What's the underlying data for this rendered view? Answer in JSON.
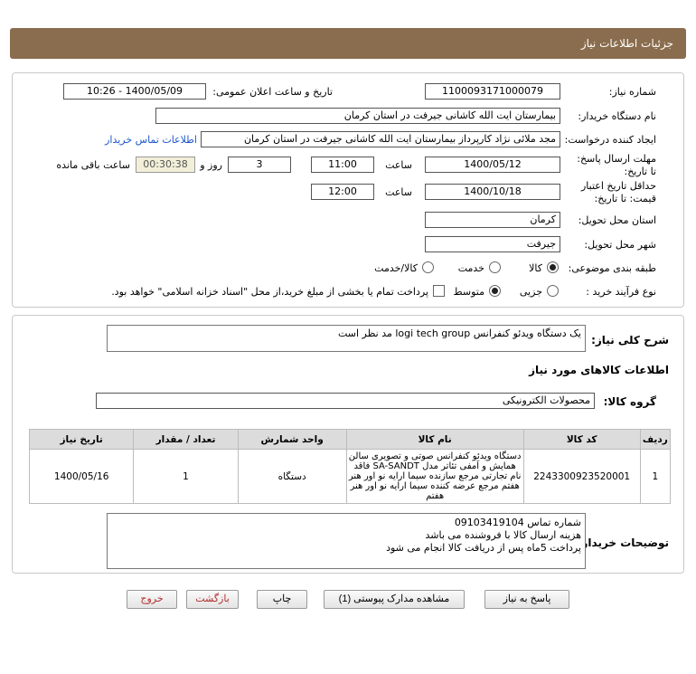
{
  "header": {
    "title": "جزئیات اطلاعات نیاز"
  },
  "form": {
    "need_number_label": "شماره نیاز:",
    "need_number": "1100093171000079",
    "announce_label": "تاریخ و ساعت اعلان عمومی:",
    "announce_value": "1400/05/09 - 10:26",
    "buyer_org_label": "نام دستگاه خریدار:",
    "buyer_org": "بیمارستان ایت الله کاشانی جیرفت در استان کرمان",
    "creator_label": "ایجاد کننده درخواست:",
    "creator": "مجد ملائی نژاد کارپرداز بیمارستان ایت الله کاشانی جیرفت در استان کرمان",
    "contact_link": "اطلاعات تماس خریدار",
    "deadline_label": "مهلت ارسال پاسخ: تا تاریخ:",
    "deadline_date": "1400/05/12",
    "time_label": "ساعت",
    "deadline_time": "11:00",
    "days_value": "3",
    "days_label": "روز و",
    "remaining_time": "00:30:38",
    "remaining_label": "ساعت باقی مانده",
    "validity_label": "حداقل تاریخ اعتبار قیمت: تا تاریخ:",
    "validity_date": "1400/10/18",
    "validity_time_label": "ساعت",
    "validity_time": "12:00",
    "province_label": "استان محل تحویل:",
    "province": "کرمان",
    "city_label": "شهر محل تحویل:",
    "city": "جیرفت",
    "category_label": "طبقه بندی موضوعی:",
    "category_options": [
      "کالا",
      "خدمت",
      "کالا/خدمت"
    ],
    "process_label": "نوع فرآیند خرید :",
    "process_options": [
      "جزیی",
      "متوسط"
    ],
    "payment_note": "پرداخت تمام یا بخشی از مبلغ خرید،از محل \"اسناد خزانه اسلامی\" خواهد بود."
  },
  "details": {
    "summary_label": "شرح کلی نیاز:",
    "summary": "یک دستگاه ویدئو کنفرانس logi tech group  مد نظر است",
    "goods_info_title": "اطلاعات کالاهای مورد نیاز",
    "goods_group_label": "گروه کالا:",
    "goods_group": "محصولات الکترونیکی",
    "table": {
      "headers": [
        "ردیف",
        "کد کالا",
        "نام کالا",
        "واحد شمارش",
        "تعداد / مقدار",
        "تاریخ نیاز"
      ],
      "rows": [
        {
          "row": "1",
          "code": "2243300923520001",
          "name": "دستگاه ویدئو کنفرانس صوتی و تصویری سالن همایش و آمفی تئاتر مدل SA-SANDT فاقد نام تجارتی مرجع سازنده سیما ارایه نو اور هنر هفتم مرجع عرضه کننده سیما ارایه نو اور هنر هفتم",
          "unit": "دستگاه",
          "qty": "1",
          "date": "1400/05/16"
        }
      ]
    },
    "buyer_notes_label": "توضیحات خریدار:",
    "buyer_notes": [
      "شماره تماس 09103419104",
      "هزینه ارسال کالا با فروشنده می باشد",
      "پرداخت 5ماه پس از دریافت کالا انجام می شود"
    ]
  },
  "buttons": {
    "reply": "پاسخ به نیاز",
    "view_docs": "مشاهده مدارک پیوستی (1)",
    "print": "چاپ",
    "back": "بازگشت",
    "exit": "خروج"
  }
}
